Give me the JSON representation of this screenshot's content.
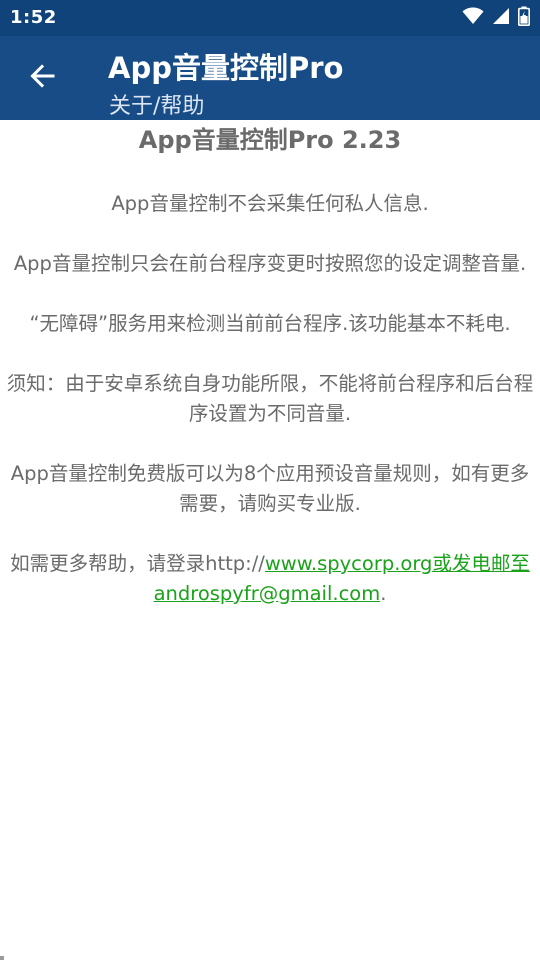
{
  "status_bar": {
    "time": "1:52",
    "icons": [
      "wifi-icon",
      "signal-icon",
      "battery-icon"
    ]
  },
  "app_bar": {
    "title": "App音量控制Pro",
    "subtitle": "关于/帮助",
    "back_icon": "arrow-back-icon"
  },
  "content": {
    "heading": "App音量控制Pro 2.23",
    "paragraphs": [
      "App音量控制不会采集任何私人信息.",
      "App音量控制只会在前台程序变更时按照您的设定调整音量.",
      "“无障碍”服务用来检测当前前台程序.该功能基本不耗电.",
      "须知：由于安卓系统自身功能所限，不能将前台程序和后台程序设置为不同音量.",
      "App音量控制免费版可以为8个应用预设音量规则，如有更多需要，请购买专业版."
    ],
    "help_prefix": "如需更多帮助，请登录http://",
    "help_link": "www.spycorp.org或发电邮至androspyfr@gmail.com",
    "help_suffix": "."
  },
  "colors": {
    "status_bar": "#0f437a",
    "app_bar": "#174c86",
    "body_text": "#6b6b6b",
    "link": "#1aa31a"
  }
}
